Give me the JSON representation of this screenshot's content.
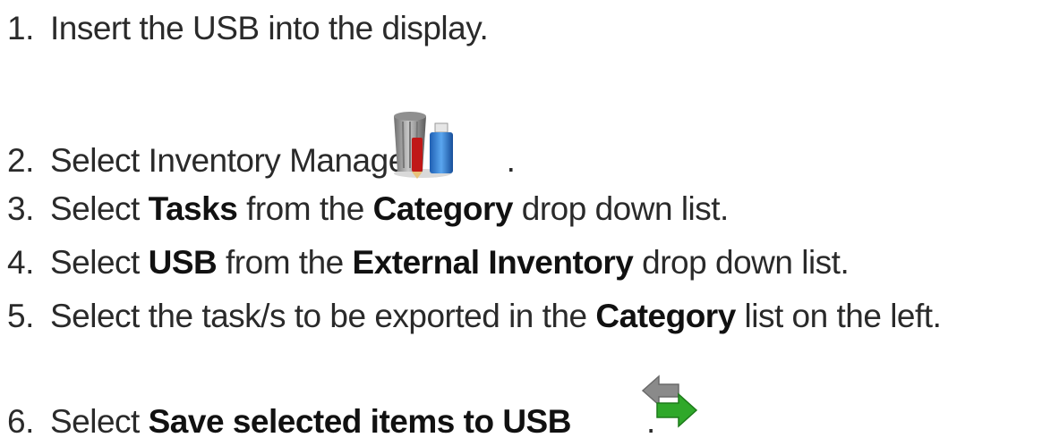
{
  "steps": [
    {
      "num": "1.",
      "parts": [
        {
          "text": "Insert the USB into the display.",
          "bold": false
        }
      ]
    },
    {
      "num": "2.",
      "parts": [
        {
          "text": "Select Inventory Manager",
          "bold": false
        }
      ],
      "icon": "inventory-manager-icon",
      "suffix": "."
    },
    {
      "num": "3.",
      "parts": [
        {
          "text": "Select ",
          "bold": false
        },
        {
          "text": "Tasks",
          "bold": true
        },
        {
          "text": " from the ",
          "bold": false
        },
        {
          "text": "Category",
          "bold": true
        },
        {
          "text": " drop down list.",
          "bold": false
        }
      ]
    },
    {
      "num": "4.",
      "parts": [
        {
          "text": "Select ",
          "bold": false
        },
        {
          "text": "USB",
          "bold": true
        },
        {
          "text": " from the ",
          "bold": false
        },
        {
          "text": "External Inventory",
          "bold": true
        },
        {
          "text": " drop down list.",
          "bold": false
        }
      ]
    },
    {
      "num": "5.",
      "parts": [
        {
          "text": "Select the task/s to be exported in the ",
          "bold": false
        },
        {
          "text": "Category",
          "bold": true
        },
        {
          "text": " list on the left.",
          "bold": false
        }
      ]
    },
    {
      "num": "6.",
      "parts": [
        {
          "text": "Select ",
          "bold": false
        },
        {
          "text": "Save selected items to USB",
          "bold": true
        }
      ],
      "icon": "save-to-usb-icon",
      "suffix": "."
    }
  ]
}
